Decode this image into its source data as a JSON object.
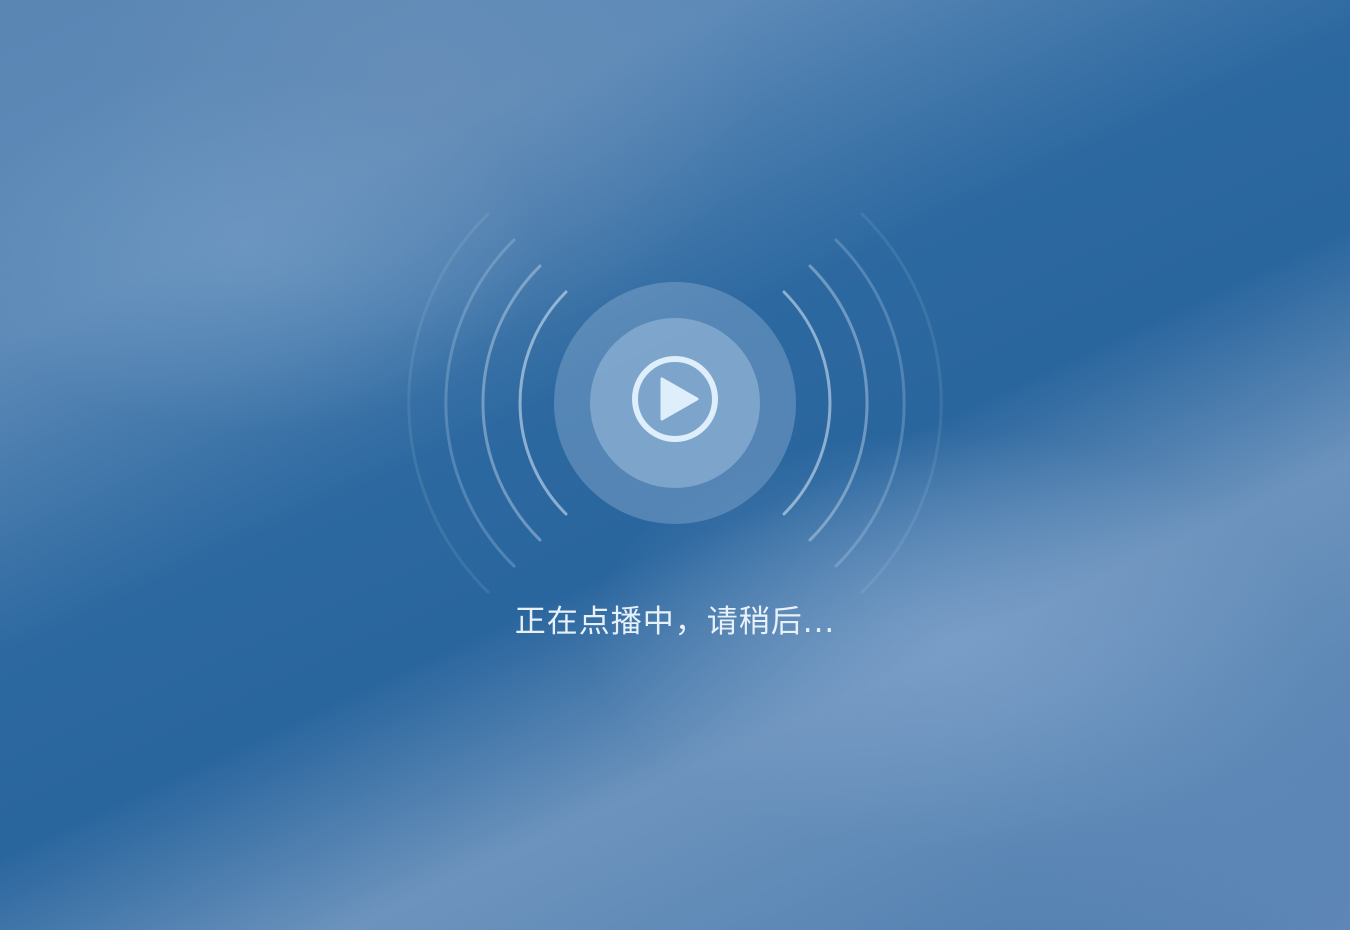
{
  "player": {
    "status_text": "正在点播中，请稍后...",
    "icon": "play-icon",
    "colors": {
      "background_dark": "#0f558d",
      "background_light": "#6c93bd",
      "ring_outer": "#7f9fc6",
      "ring_inner": "#8fb0d4",
      "icon": "#deeefb",
      "text": "#e8f1fa"
    }
  }
}
